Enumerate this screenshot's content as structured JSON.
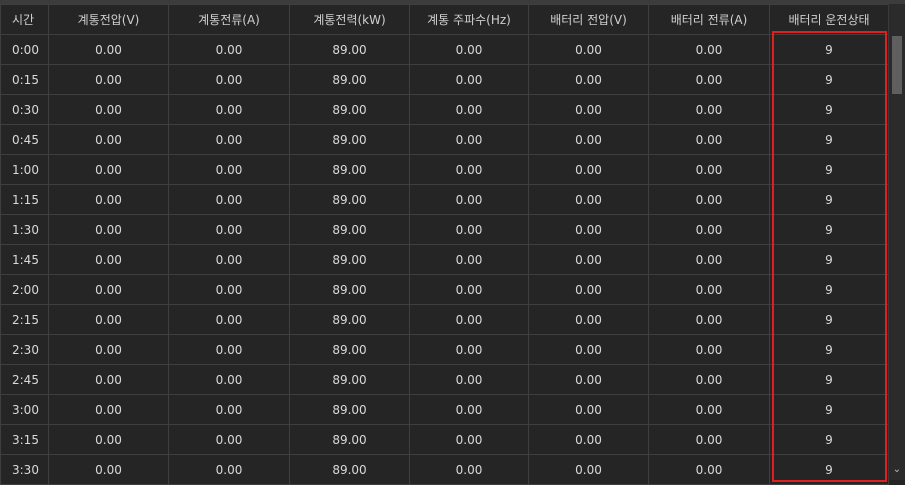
{
  "table": {
    "columns": [
      "시간",
      "계통전압(V)",
      "계통전류(A)",
      "계통전력(kW)",
      "계통 주파수(Hz)",
      "배터리 전압(V)",
      "배터리 전류(A)",
      "배터리 운전상태"
    ],
    "rows": [
      [
        "0:00",
        "0.00",
        "0.00",
        "89.00",
        "0.00",
        "0.00",
        "0.00",
        "9"
      ],
      [
        "0:15",
        "0.00",
        "0.00",
        "89.00",
        "0.00",
        "0.00",
        "0.00",
        "9"
      ],
      [
        "0:30",
        "0.00",
        "0.00",
        "89.00",
        "0.00",
        "0.00",
        "0.00",
        "9"
      ],
      [
        "0:45",
        "0.00",
        "0.00",
        "89.00",
        "0.00",
        "0.00",
        "0.00",
        "9"
      ],
      [
        "1:00",
        "0.00",
        "0.00",
        "89.00",
        "0.00",
        "0.00",
        "0.00",
        "9"
      ],
      [
        "1:15",
        "0.00",
        "0.00",
        "89.00",
        "0.00",
        "0.00",
        "0.00",
        "9"
      ],
      [
        "1:30",
        "0.00",
        "0.00",
        "89.00",
        "0.00",
        "0.00",
        "0.00",
        "9"
      ],
      [
        "1:45",
        "0.00",
        "0.00",
        "89.00",
        "0.00",
        "0.00",
        "0.00",
        "9"
      ],
      [
        "2:00",
        "0.00",
        "0.00",
        "89.00",
        "0.00",
        "0.00",
        "0.00",
        "9"
      ],
      [
        "2:15",
        "0.00",
        "0.00",
        "89.00",
        "0.00",
        "0.00",
        "0.00",
        "9"
      ],
      [
        "2:30",
        "0.00",
        "0.00",
        "89.00",
        "0.00",
        "0.00",
        "0.00",
        "9"
      ],
      [
        "2:45",
        "0.00",
        "0.00",
        "89.00",
        "0.00",
        "0.00",
        "0.00",
        "9"
      ],
      [
        "3:00",
        "0.00",
        "0.00",
        "89.00",
        "0.00",
        "0.00",
        "0.00",
        "9"
      ],
      [
        "3:15",
        "0.00",
        "0.00",
        "89.00",
        "0.00",
        "0.00",
        "0.00",
        "9"
      ],
      [
        "3:30",
        "0.00",
        "0.00",
        "89.00",
        "0.00",
        "0.00",
        "0.00",
        "9"
      ]
    ]
  },
  "scrollbar": {
    "down_arrow": "⌄"
  },
  "colors": {
    "background": "#252526",
    "grid": "#3f3f3f",
    "text": "#d9d9d9",
    "highlight": "#e02020"
  }
}
